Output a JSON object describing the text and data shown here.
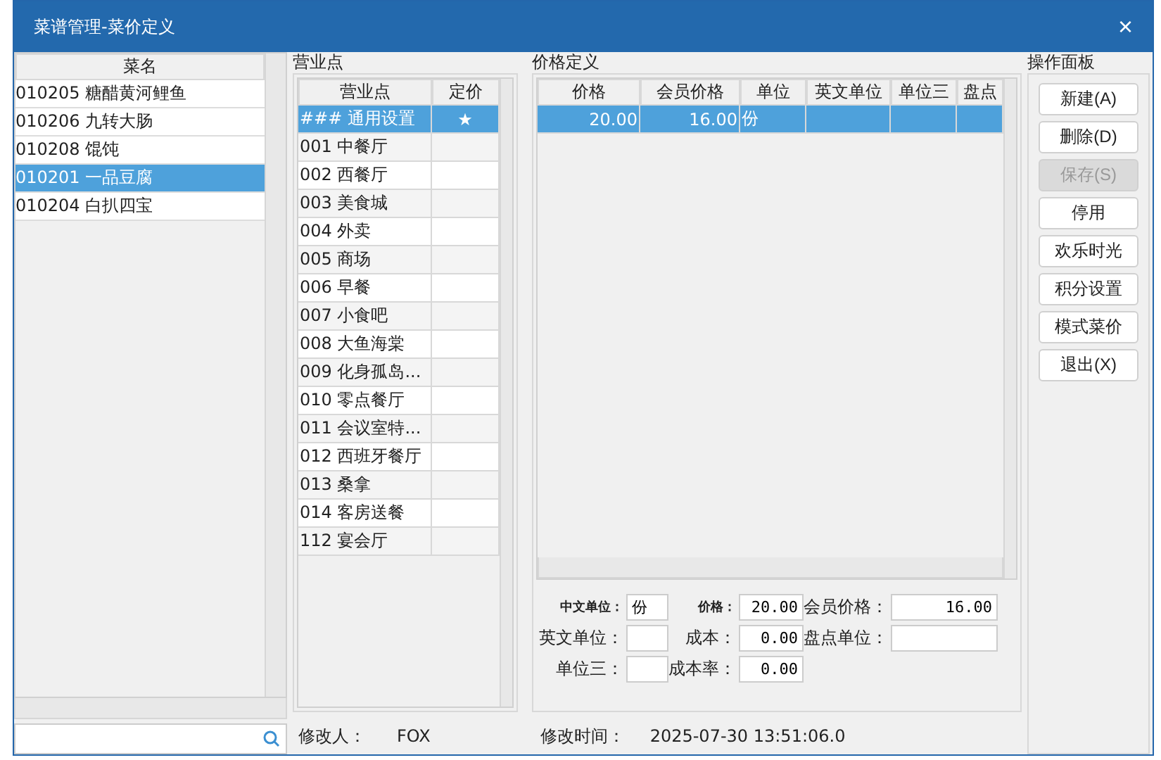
{
  "window": {
    "title": "菜谱管理-菜价定义",
    "close": "×"
  },
  "dishes": {
    "header": "菜名",
    "items": [
      {
        "code": "010205",
        "name": "糖醋黄河鲤鱼",
        "selected": false
      },
      {
        "code": "010206",
        "name": "九转大肠",
        "selected": false
      },
      {
        "code": "010208",
        "name": "馄饨",
        "selected": false
      },
      {
        "code": "010201",
        "name": "一品豆腐",
        "selected": true
      },
      {
        "code": "010204",
        "name": "白扒四宝",
        "selected": false
      }
    ]
  },
  "outlets": {
    "legend": "营业点",
    "columns": [
      "营业点",
      "定价"
    ],
    "rows": [
      {
        "code": "###",
        "name": "通用设置",
        "price_mark": "★",
        "selected": true
      },
      {
        "code": "001",
        "name": "中餐厅",
        "selected": false
      },
      {
        "code": "002",
        "name": "西餐厅",
        "selected": false
      },
      {
        "code": "003",
        "name": "美食城",
        "selected": false
      },
      {
        "code": "004",
        "name": "外卖",
        "selected": false
      },
      {
        "code": "005",
        "name": "商场",
        "selected": false
      },
      {
        "code": "006",
        "name": "早餐",
        "selected": false
      },
      {
        "code": "007",
        "name": "小食吧",
        "selected": false
      },
      {
        "code": "008",
        "name": "大鱼海棠",
        "selected": false
      },
      {
        "code": "009",
        "name": "化身孤岛...",
        "selected": false
      },
      {
        "code": "010",
        "name": "零点餐厅",
        "selected": false
      },
      {
        "code": "011",
        "name": "会议室特...",
        "selected": false
      },
      {
        "code": "012",
        "name": "西班牙餐厅",
        "selected": false
      },
      {
        "code": "013",
        "name": "桑拿",
        "selected": false
      },
      {
        "code": "014",
        "name": "客房送餐",
        "selected": false
      },
      {
        "code": "112",
        "name": "宴会厅",
        "selected": false
      }
    ]
  },
  "prices": {
    "legend": "价格定义",
    "columns": [
      "价格",
      "会员价格",
      "单位",
      "英文单位",
      "单位三",
      "盘点"
    ],
    "rows": [
      {
        "cells": [
          "20.00",
          "16.00",
          "份"
        ],
        "selected": true
      }
    ]
  },
  "form": {
    "rows": [
      [
        {
          "label": "中文单位：",
          "value": "份",
          "kind": "small"
        },
        {
          "label": "价格：",
          "value": "20.00",
          "kind": "small"
        },
        {
          "label": "会员价格：",
          "value": "16.00",
          "kind": "normal"
        }
      ],
      [
        {
          "label": "英文单位：",
          "kind": "normal"
        },
        {
          "label": "成本：",
          "value": "0.00",
          "kind": "normal"
        },
        {
          "label": "盘点单位：",
          "kind": "normal"
        }
      ],
      [
        {
          "label": "单位三：",
          "kind": "normal"
        },
        {
          "label": "成本率：",
          "value": "0.00",
          "kind": "normal"
        }
      ]
    ]
  },
  "footer": {
    "modifier_label": "修改人：",
    "modifier": "FOX",
    "time_label": "修改时间：",
    "time": "2025-07-30 13:51:06.0"
  },
  "actions": {
    "legend": "操作面板",
    "buttons": [
      {
        "label": "新建(A)",
        "disabled": false
      },
      {
        "label": "删除(D)",
        "disabled": false
      },
      {
        "label": "保存(S)",
        "disabled": true
      },
      {
        "label": "停用",
        "disabled": false
      },
      {
        "label": "欢乐时光",
        "disabled": false
      },
      {
        "label": "积分设置",
        "disabled": false
      },
      {
        "label": "模式菜价",
        "disabled": false
      },
      {
        "label": "退出(X)",
        "disabled": false
      }
    ]
  }
}
